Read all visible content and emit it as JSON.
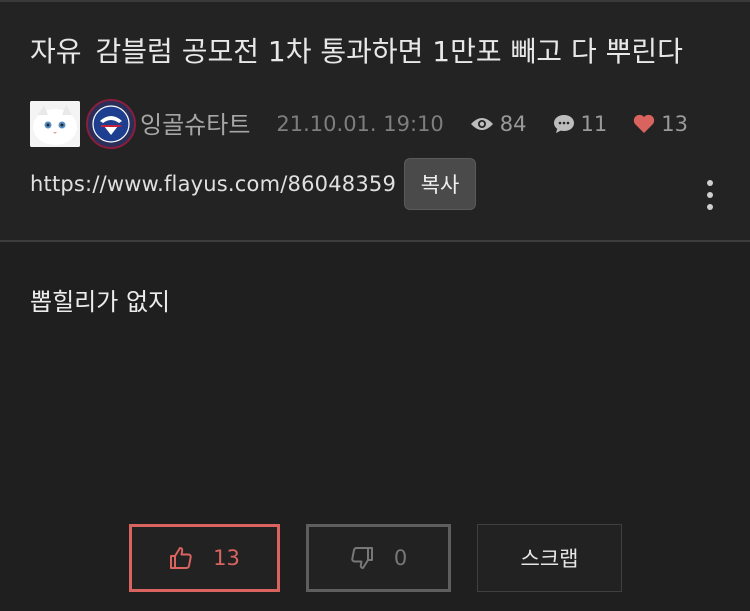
{
  "post": {
    "category": "자유",
    "title": "감블럼 공모전 1차 통과하면 1만포 빼고 다 뿌린다",
    "author": "잉골슈타트",
    "datetime": "21.10.01. 19:10",
    "views": "84",
    "comments": "11",
    "likes": "13",
    "url": "https://www.flayus.com/86048359",
    "copy_label": "복사",
    "body": "뽑힐리가 없지"
  },
  "actions": {
    "like_count": "13",
    "dislike_count": "0",
    "scrap_label": "스크랩"
  },
  "colors": {
    "accent_like": "#d9645f",
    "background": "#1f1f1f",
    "header_bg": "#232323"
  },
  "icons": [
    "eye-icon",
    "comment-icon",
    "heart-icon",
    "thumbs-up-icon",
    "thumbs-down-icon",
    "more-vertical-icon"
  ]
}
